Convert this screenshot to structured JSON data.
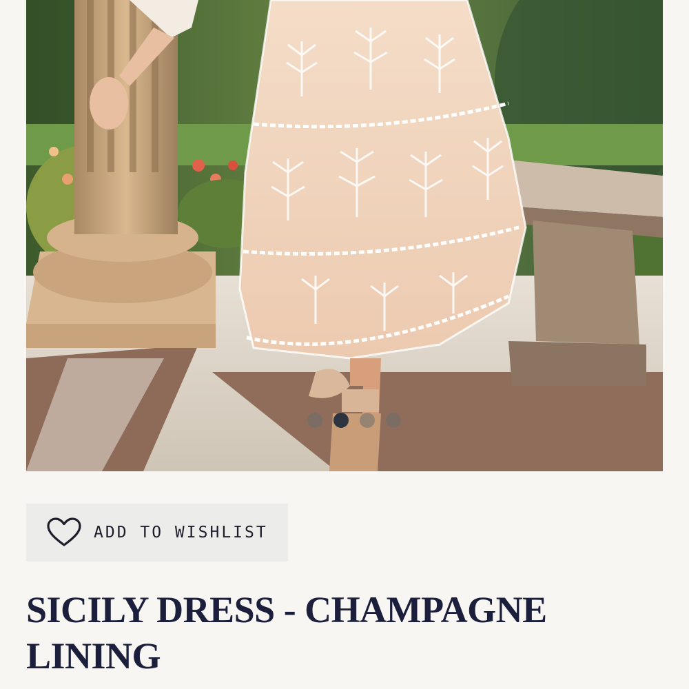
{
  "product": {
    "title": "SICILY DRESS - CHAMPAGNE LINING",
    "image_alt": "Sicily Dress in champagne lining with white floral lace overlay"
  },
  "carousel": {
    "dots": [
      {
        "active": false
      },
      {
        "active": true
      },
      {
        "active": false
      },
      {
        "active": false
      }
    ]
  },
  "wishlist": {
    "label": "ADD TO WISHLIST",
    "icon": "heart-outline-icon"
  },
  "colors": {
    "background": "#f7f6f2",
    "title": "#1c1f3b",
    "button_bg": "#ececea",
    "active_dot": "#2d3440"
  }
}
